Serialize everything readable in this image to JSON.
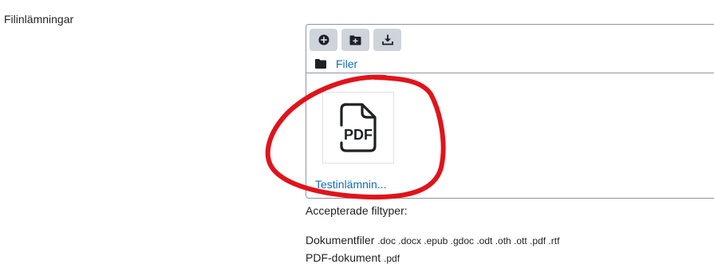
{
  "field": {
    "label": "Filinlämningar"
  },
  "filemanager": {
    "toolbar": {
      "buttons": [
        {
          "icon": "add-file-icon"
        },
        {
          "icon": "create-folder-icon"
        },
        {
          "icon": "download-icon"
        }
      ]
    },
    "path": {
      "label": "Filer"
    },
    "files": [
      {
        "name": "Testinlämnin...",
        "type_label": "PDF"
      }
    ]
  },
  "accepted": {
    "title": "Accepterade filtyper:",
    "types": [
      {
        "name": "Dokumentfiler",
        "extensions": ".doc .docx .epub .gdoc .odt .oth .ott .pdf .rtf"
      },
      {
        "name": "PDF-dokument",
        "extensions": ".pdf"
      }
    ]
  },
  "colors": {
    "link": "#0f6cbf",
    "annotation": "#e0141b",
    "button_bg": "#ced4da"
  }
}
